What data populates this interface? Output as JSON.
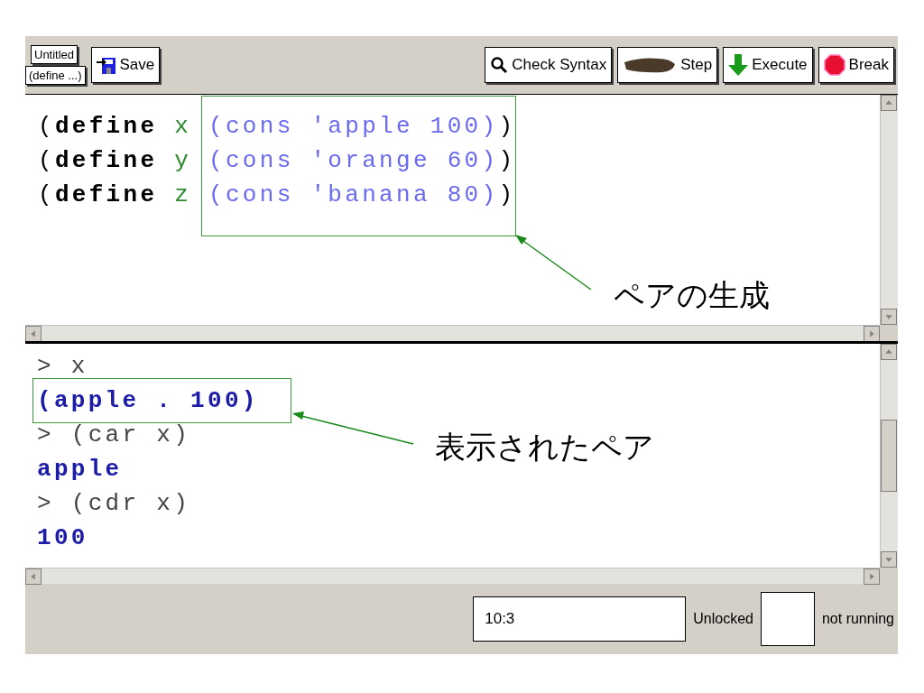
{
  "toolbar": {
    "file_name": "Untitled",
    "definitions_menu": "(define ...)",
    "left_buttons": [
      {
        "kind": "save",
        "label": "Save"
      }
    ],
    "right_buttons": [
      {
        "kind": "check",
        "label": "Check Syntax"
      },
      {
        "kind": "step",
        "label": "Step"
      },
      {
        "kind": "execute",
        "label": "Execute"
      },
      {
        "kind": "break",
        "label": "Break"
      }
    ]
  },
  "definitions": {
    "lines": [
      [
        {
          "kind": "paren",
          "text": "("
        },
        {
          "kind": "keyword",
          "text": "define"
        },
        {
          "kind": "name",
          "text": " x "
        },
        {
          "kind": "expr",
          "text": "(cons 'apple 100)"
        },
        {
          "kind": "paren",
          "text": ")"
        }
      ],
      [
        {
          "kind": "paren",
          "text": "("
        },
        {
          "kind": "keyword",
          "text": "define"
        },
        {
          "kind": "name",
          "text": " y "
        },
        {
          "kind": "expr",
          "text": "(cons 'orange 60)"
        },
        {
          "kind": "paren",
          "text": ")"
        }
      ],
      [
        {
          "kind": "paren",
          "text": "("
        },
        {
          "kind": "keyword",
          "text": "define"
        },
        {
          "kind": "name",
          "text": " z "
        },
        {
          "kind": "expr",
          "text": "(cons 'banana 80)"
        },
        {
          "kind": "paren",
          "text": ")"
        }
      ]
    ],
    "annotation": "ペアの生成"
  },
  "interactions": {
    "lines": [
      {
        "kind": "input",
        "text": "> x",
        "highlighted": false
      },
      {
        "kind": "output",
        "text": "(apple . 100)",
        "highlighted": true
      },
      {
        "kind": "input",
        "text": "> (car x)",
        "highlighted": false
      },
      {
        "kind": "output",
        "text": "apple",
        "highlighted": false
      },
      {
        "kind": "input",
        "text": "> (cdr x)",
        "highlighted": false
      },
      {
        "kind": "output",
        "text": "100",
        "highlighted": false
      }
    ],
    "annotation": "表示されたペア"
  },
  "status_bar": {
    "position": "10:3",
    "lock": "Unlocked",
    "state": "not running"
  }
}
